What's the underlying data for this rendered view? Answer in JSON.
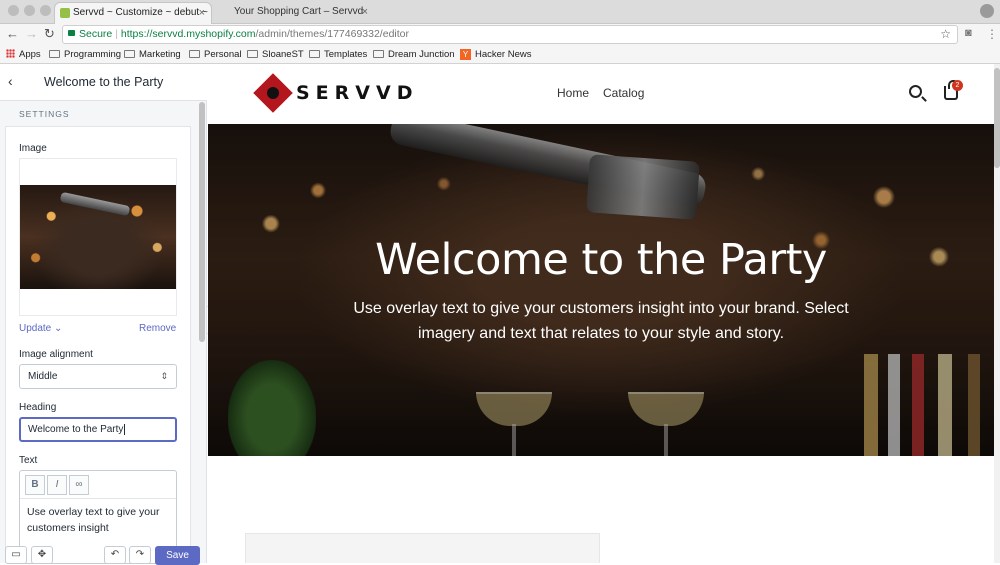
{
  "browser": {
    "tabs": [
      {
        "title": "Servvd ~ Customize ~ debut ~",
        "active": true
      },
      {
        "title": "Your Shopping Cart – Servvd",
        "active": false
      }
    ],
    "secure_label": "Secure",
    "url_host": "https://servvd.myshopify.com",
    "url_path": "/admin/themes/177469332/editor",
    "bookmarks": [
      "Apps",
      "Programming",
      "Marketing",
      "Personal",
      "SloaneST",
      "Templates",
      "Dream Junction",
      "Hacker News"
    ],
    "hacker_news_badge": "Y"
  },
  "sidebar": {
    "title": "Welcome to the Party",
    "section_label": "SETTINGS",
    "image_label": "Image",
    "update_link": "Update",
    "remove_link": "Remove",
    "alignment_label": "Image alignment",
    "alignment_value": "Middle",
    "heading_label": "Heading",
    "heading_value": "Welcome to the Party",
    "text_label": "Text",
    "rte_bold": "B",
    "rte_italic": "I",
    "rte_text": "Use overlay text to give your customers insight",
    "save_label": "Save"
  },
  "store": {
    "logo_text": "SERVVD",
    "nav": [
      "Home",
      "Catalog"
    ],
    "cart_count": "2",
    "hero_title": "Welcome to the Party",
    "hero_text": "Use overlay text to give your customers insight into your brand. Select imagery and text that relates to your style and story."
  },
  "colors": {
    "accent": "#5c6ac4",
    "brand": "#b3161c",
    "secure": "#0b8043",
    "badge": "#d0341c"
  }
}
